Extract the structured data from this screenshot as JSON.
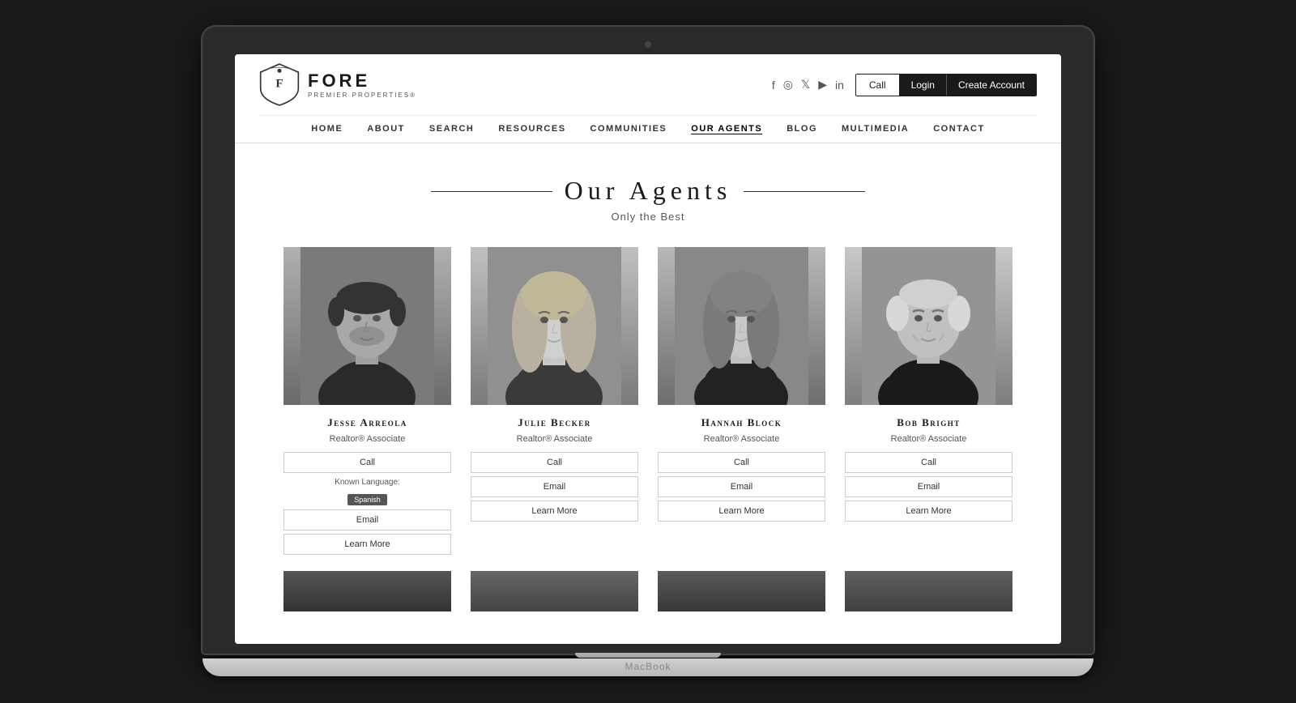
{
  "laptop": {
    "brand": "MacBook"
  },
  "header": {
    "logo_name": "FORE",
    "logo_sub": "PREMIER PROPERTIES®",
    "social": [
      "f",
      "✦",
      "𝕏",
      "▶",
      "in"
    ],
    "btn_call": "Call",
    "btn_login": "Login",
    "btn_create": "Create Account"
  },
  "nav": {
    "items": [
      "HOME",
      "ABOUT",
      "SEARCH",
      "RESOURCES",
      "COMMUNITIES",
      "OUR AGENTS",
      "BLOG",
      "MULTIMEDIA",
      "CONTACT"
    ],
    "active": "OUR AGENTS"
  },
  "page": {
    "title": "Our Agents",
    "subtitle": "Only the Best"
  },
  "agents": [
    {
      "name": "Jesse Arreola",
      "title": "Realtor® Associate",
      "known_language_label": "Known Language:",
      "language_badge": "Spanish",
      "actions": [
        "Call",
        "Email",
        "Learn More"
      ]
    },
    {
      "name": "Julie Becker",
      "title": "Realtor® Associate",
      "actions": [
        "Call",
        "Email",
        "Learn More"
      ]
    },
    {
      "name": "Hannah Block",
      "title": "Realtor® Associate",
      "actions": [
        "Call",
        "Email",
        "Learn More"
      ]
    },
    {
      "name": "Bob Bright",
      "title": "Realtor® Associate",
      "actions": [
        "Call",
        "Email",
        "Learn More"
      ]
    }
  ]
}
